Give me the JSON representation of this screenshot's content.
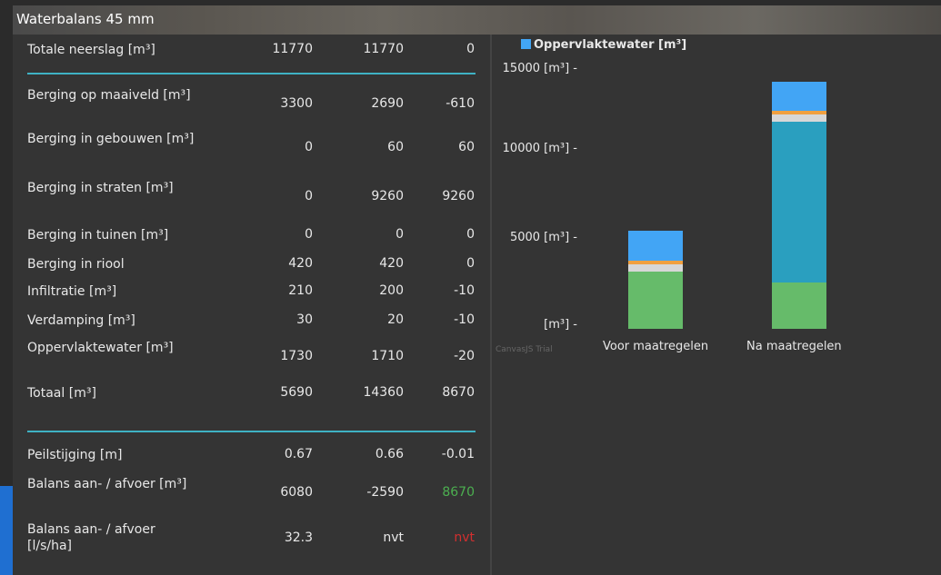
{
  "title": "Waterbalans 45 mm",
  "rows": [
    {
      "label": "Totale neerslag [m³]",
      "v1": "11770",
      "v2": "11770",
      "v3": "0"
    },
    {
      "label": "Berging op maaiveld [m³]",
      "v1": "3300",
      "v2": "2690",
      "v3": "-610"
    },
    {
      "label": "Berging in gebouwen [m³]",
      "v1": "0",
      "v2": "60",
      "v3": "60"
    },
    {
      "label": "Berging in straten [m³]",
      "v1": "0",
      "v2": "9260",
      "v3": "9260"
    },
    {
      "label": "Berging in tuinen [m³]",
      "v1": "0",
      "v2": "0",
      "v3": "0"
    },
    {
      "label": "Berging in riool",
      "v1": "420",
      "v2": "420",
      "v3": "0"
    },
    {
      "label": "Infiltratie [m³]",
      "v1": "210",
      "v2": "200",
      "v3": "-10"
    },
    {
      "label": "Verdamping [m³]",
      "v1": "30",
      "v2": "20",
      "v3": "-10"
    },
    {
      "label": "Oppervlaktewater [m³]",
      "v1": "1730",
      "v2": "1710",
      "v3": "-20"
    },
    {
      "label": "Totaal [m³]",
      "v1": "5690",
      "v2": "14360",
      "v3": "8670"
    },
    {
      "label": "Peilstijging [m]",
      "v1": "0.67",
      "v2": "0.66",
      "v3": "-0.01"
    },
    {
      "label": "Balans aan- / afvoer [m³]",
      "v1": "6080",
      "v2": "-2590",
      "v3": "8670"
    },
    {
      "label": "Balans aan- / afvoer [l/s/ha]",
      "v1": "32.3",
      "v2": "nvt",
      "v3": "nvt"
    }
  ],
  "colors": {
    "positive": "#4caf50",
    "negative": "#d32f2f",
    "separator": "#3fb2c4"
  },
  "chart_data": {
    "type": "bar",
    "legend": "Oppervlaktewater [m³]",
    "categories": [
      "Voor maatregelen",
      "Na maatregelen"
    ],
    "y_tick_labels": [
      "15000 [m³] -",
      "10000 [m³] -",
      "5000 [m³] -",
      "[m³] -"
    ],
    "ylim": [
      0,
      15000
    ],
    "series": [
      {
        "values": [
          3300,
          2690
        ],
        "color": "#66bb6a"
      },
      {
        "values": [
          0,
          9260
        ],
        "color": "#2a9fbf"
      },
      {
        "values": [
          420,
          420
        ],
        "color": "#d7d7d7"
      },
      {
        "values": [
          210,
          200
        ],
        "color": "#f0a040"
      },
      {
        "values": [
          1730,
          1710
        ],
        "color": "#42a5f5"
      }
    ],
    "watermark": "CanvasJS Trial"
  }
}
